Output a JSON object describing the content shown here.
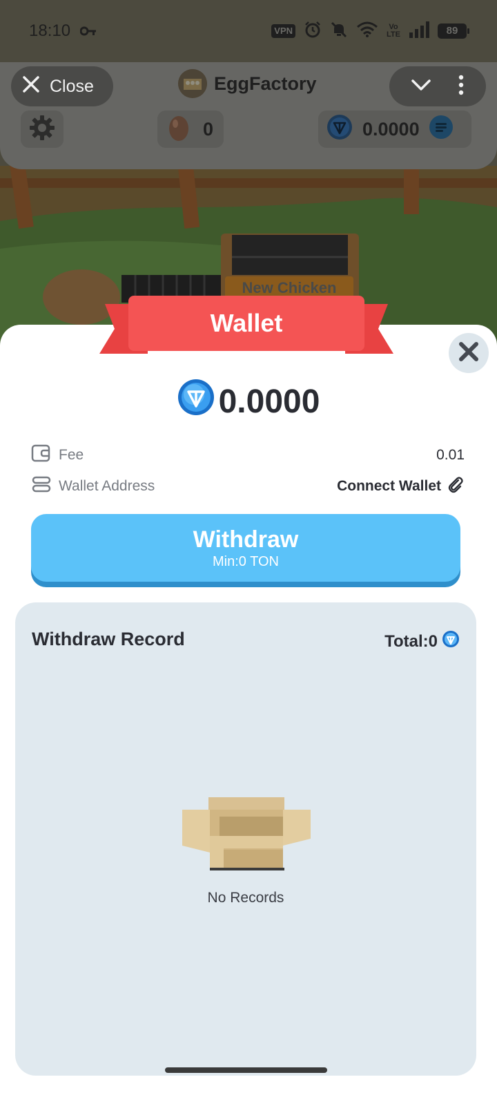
{
  "status_bar": {
    "time": "18:10",
    "vpn_label": "VPN",
    "volte_top": "Vo",
    "volte_bottom": "LTE",
    "battery": "89"
  },
  "app_header": {
    "close_label": "Close",
    "title": "EggFactory",
    "egg_count": "0",
    "ton_balance": "0.0000"
  },
  "scene": {
    "crate_label": "New Chicken"
  },
  "wallet": {
    "ribbon_title": "Wallet",
    "balance": "0.0000",
    "fee_label": "Fee",
    "fee_value": "0.01",
    "address_label": "Wallet Address",
    "address_action": "Connect Wallet",
    "withdraw_label": "Withdraw",
    "withdraw_min": "Min:0 TON"
  },
  "record": {
    "title": "Withdraw Record",
    "total": "Total:0",
    "empty_text": "No Records"
  },
  "colors": {
    "accent": "#5bc2f9",
    "ribbon": "#f45454",
    "panel_bg": "#ffffff",
    "record_bg": "#e0e9ef"
  },
  "icons": [
    "key-icon",
    "alarm-icon",
    "mute-icon",
    "wifi-icon",
    "signal-icon",
    "close-icon",
    "chevron-down-icon",
    "more-vert-icon",
    "gear-icon",
    "egg-icon",
    "ton-coin-icon",
    "swap-icon",
    "wallet-icon",
    "server-icon",
    "paperclip-icon",
    "empty-box-icon"
  ]
}
